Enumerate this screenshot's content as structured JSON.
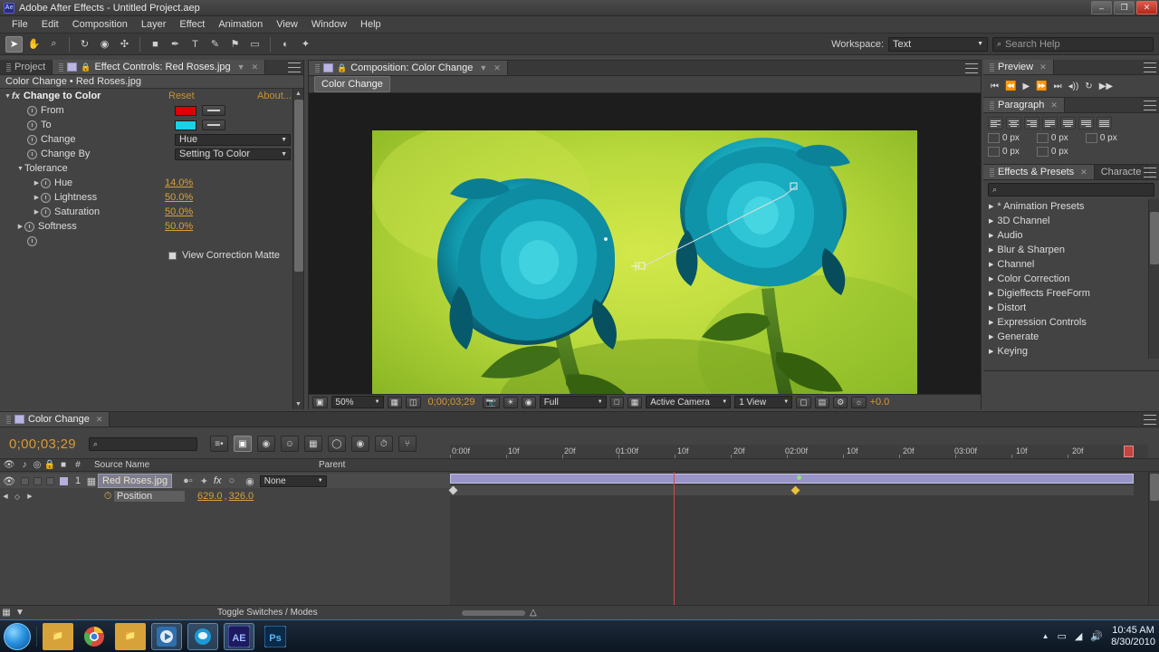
{
  "window": {
    "title": "Adobe After Effects - Untitled Project.aep",
    "app_badge": "Ae",
    "minimize": "–",
    "maximize": "❐",
    "close": "✕"
  },
  "menubar": {
    "items": [
      "File",
      "Edit",
      "Composition",
      "Layer",
      "Effect",
      "Animation",
      "View",
      "Window",
      "Help"
    ]
  },
  "toolbar": {
    "tools": [
      {
        "name": "selection-tool",
        "glyph": "➤"
      },
      {
        "name": "hand-tool",
        "glyph": "✋"
      },
      {
        "name": "zoom-tool",
        "glyph": "⌕"
      },
      {
        "name": "rotation-tool",
        "glyph": "↻"
      },
      {
        "name": "camera-tool",
        "glyph": "◉"
      },
      {
        "name": "pan-behind-tool",
        "glyph": "✣"
      },
      {
        "name": "shape-tool",
        "glyph": "■"
      },
      {
        "name": "pen-tool",
        "glyph": "✒"
      },
      {
        "name": "type-tool",
        "glyph": "T"
      },
      {
        "name": "brush-tool",
        "glyph": "✎"
      },
      {
        "name": "clone-stamp-tool",
        "glyph": "⚑"
      },
      {
        "name": "eraser-tool",
        "glyph": "▭"
      },
      {
        "name": "roto-brush-tool",
        "glyph": "◐"
      },
      {
        "name": "puppet-pin-tool",
        "glyph": "✦"
      }
    ],
    "workspace_label": "Workspace:",
    "workspace_value": "Text",
    "search_placeholder": "Search Help",
    "search_icon": "⌕"
  },
  "effect_controls": {
    "tabs": [
      {
        "label": "Project",
        "active": false
      },
      {
        "label": "Effect Controls: Red Roses.jpg",
        "active": true
      }
    ],
    "close_glyph": "✕",
    "dropdown_glyph": "▼",
    "header": "Color Change • Red Roses.jpg",
    "effect_name": "Change to Color",
    "fx_label": "fx",
    "reset_label": "Reset",
    "about_label": "About...",
    "params": [
      {
        "label": "From",
        "type": "color",
        "value": "#e00000"
      },
      {
        "label": "To",
        "type": "color",
        "value": "#1ad2e6"
      },
      {
        "label": "Change",
        "type": "dropdown",
        "value": "Hue"
      },
      {
        "label": "Change By",
        "type": "dropdown",
        "value": "Setting To Color"
      }
    ],
    "tolerance_label": "Tolerance",
    "tolerance_params": [
      {
        "label": "Hue",
        "value": "14.0%"
      },
      {
        "label": "Lightness",
        "value": "50.0%"
      },
      {
        "label": "Saturation",
        "value": "50.0%"
      }
    ],
    "softness_label": "Softness",
    "softness_value": "50.0%",
    "matte_label": "View Correction Matte"
  },
  "composition": {
    "tab_label": "Composition: Color Change",
    "close_glyph": "✕",
    "dropdown_glyph": "▼",
    "breadcrumb": "Color Change",
    "bottom": {
      "zoom": "50%",
      "timecode": "0;00;03;29",
      "resolution": "Full",
      "camera": "Active Camera",
      "views": "1 View",
      "exposure": "+0.0"
    }
  },
  "preview": {
    "tab_label": "Preview",
    "close_glyph": "✕",
    "buttons": [
      {
        "name": "first-frame-button",
        "glyph": "⏮"
      },
      {
        "name": "previous-frame-button",
        "glyph": "⏪"
      },
      {
        "name": "play-button",
        "glyph": "▶"
      },
      {
        "name": "next-frame-button",
        "glyph": "⏩"
      },
      {
        "name": "last-frame-button",
        "glyph": "⏭"
      },
      {
        "name": "audio-button",
        "glyph": "◂))"
      },
      {
        "name": "loop-button",
        "glyph": "↻"
      },
      {
        "name": "ram-preview-button",
        "glyph": "▶▶"
      }
    ]
  },
  "paragraph": {
    "tab_label": "Paragraph",
    "close_glyph": "✕",
    "align_buttons": [
      "align-left",
      "align-center",
      "align-right",
      "justify-last-left",
      "justify-last-center",
      "justify-last-right",
      "justify-all"
    ],
    "indent_fields": [
      {
        "name": "indent-left",
        "value": "0 px"
      },
      {
        "name": "indent-right",
        "value": "0 px"
      },
      {
        "name": "indent-first-line",
        "value": "0 px"
      },
      {
        "name": "space-before",
        "value": "0 px"
      },
      {
        "name": "space-after",
        "value": "0 px"
      }
    ]
  },
  "effects_presets": {
    "tabs": [
      {
        "label": "Effects & Presets",
        "active": true
      },
      {
        "label": "Characte",
        "active": false
      }
    ],
    "close_glyph": "✕",
    "search_icon": "⌕",
    "search_value": "",
    "categories": [
      "* Animation Presets",
      "3D Channel",
      "Audio",
      "Blur & Sharpen",
      "Channel",
      "Color Correction",
      "Digieffects FreeForm",
      "Distort",
      "Expression Controls",
      "Generate",
      "Keying"
    ],
    "expand_glyph": "▶"
  },
  "timeline": {
    "tab_label": "Color Change",
    "close_glyph": "✕",
    "current_time": "0;00;03;29",
    "search_placeholder": "",
    "search_icon": "⌕",
    "columns": [
      "#",
      "Source Name",
      "Parent"
    ],
    "layer": {
      "index": "1",
      "name": "Red Roses.jpg",
      "parent_value": "None",
      "mode_glyphs": [
        "◈",
        "fx",
        "○"
      ],
      "property_label": "Position",
      "property_value": "629.0 , 326.0",
      "property_value_x": "629.0",
      "property_value_y": "326.0"
    },
    "ruler_labels": [
      "0:00f",
      "10f",
      "20f",
      "01:00f",
      "10f",
      "20f",
      "02:00f",
      "10f",
      "20f",
      "03:00f",
      "10f",
      "20f"
    ],
    "switches_label": "Toggle Switches / Modes"
  },
  "taskbar": {
    "start_name": "start-orb",
    "items": [
      {
        "name": "explorer",
        "glyph": "🗀"
      },
      {
        "name": "chrome",
        "glyph": "◉"
      },
      {
        "name": "folder",
        "glyph": "🗁"
      },
      {
        "name": "media-player",
        "glyph": "▶"
      },
      {
        "name": "messenger",
        "glyph": "●"
      },
      {
        "name": "after-effects",
        "glyph": "AE"
      },
      {
        "name": "photoshop",
        "glyph": "Ps"
      }
    ],
    "tray": [
      {
        "name": "show-hidden-icons",
        "glyph": "▲"
      },
      {
        "name": "removable-media-icon",
        "glyph": "▭"
      },
      {
        "name": "network-icon",
        "glyph": "◢"
      },
      {
        "name": "volume-icon",
        "glyph": "🔊"
      }
    ],
    "time": "10:45 AM",
    "date": "8/30/2010"
  },
  "colors": {
    "accent_orange": "#d79a35",
    "from_color": "#e00000",
    "to_color": "#1ad2e6",
    "cti_red": "#c2453f",
    "keyframe_yellow": "#e8c03a"
  }
}
